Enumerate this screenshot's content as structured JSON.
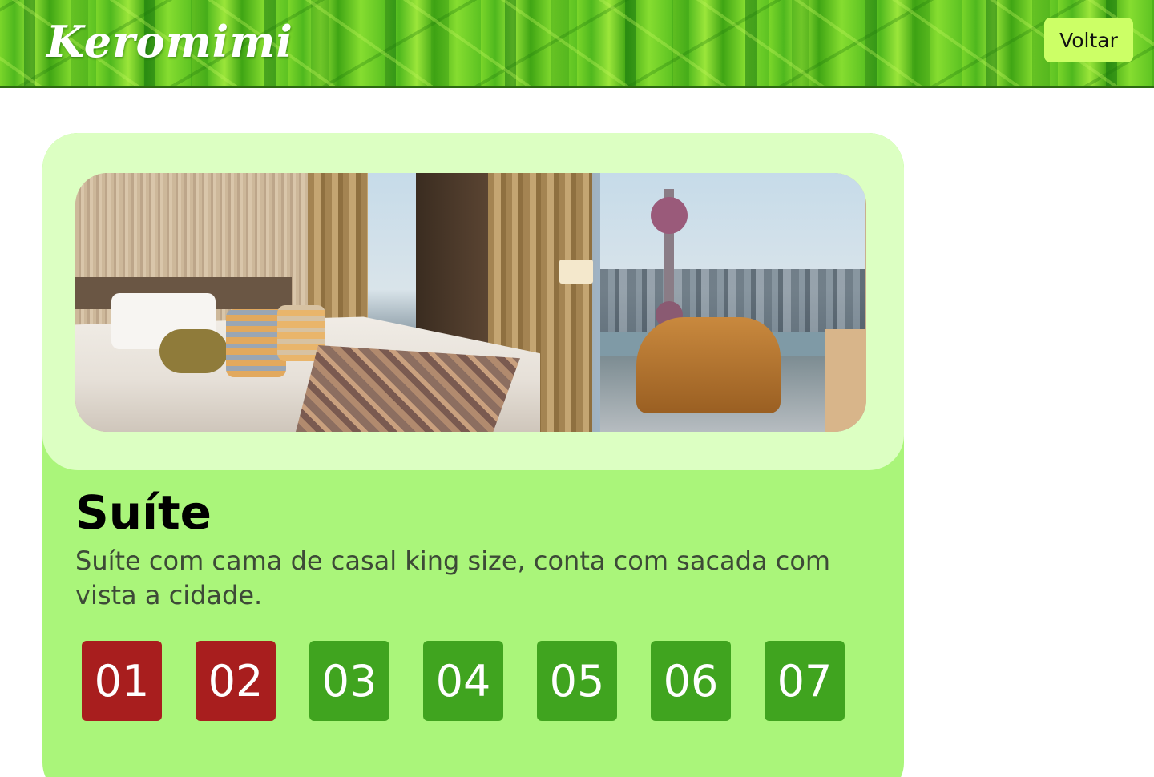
{
  "header": {
    "brand": "Keromimi",
    "back_label": "Voltar"
  },
  "room_card": {
    "photo_icon": "hotel-suite-photo",
    "title": "Suíte",
    "description": "Suíte com cama de casal king size, conta com sacada com vista a cidade."
  },
  "rooms": [
    {
      "number": "01",
      "status": "occupied"
    },
    {
      "number": "02",
      "status": "occupied"
    },
    {
      "number": "03",
      "status": "free"
    },
    {
      "number": "04",
      "status": "free"
    },
    {
      "number": "05",
      "status": "free"
    },
    {
      "number": "06",
      "status": "free"
    },
    {
      "number": "07",
      "status": "free"
    }
  ],
  "colors": {
    "occupied": "#a81e1e",
    "free": "#40a41f",
    "card": "#aaf57a",
    "photo_panel": "#dcffc2",
    "back_button": "#ccff66"
  }
}
